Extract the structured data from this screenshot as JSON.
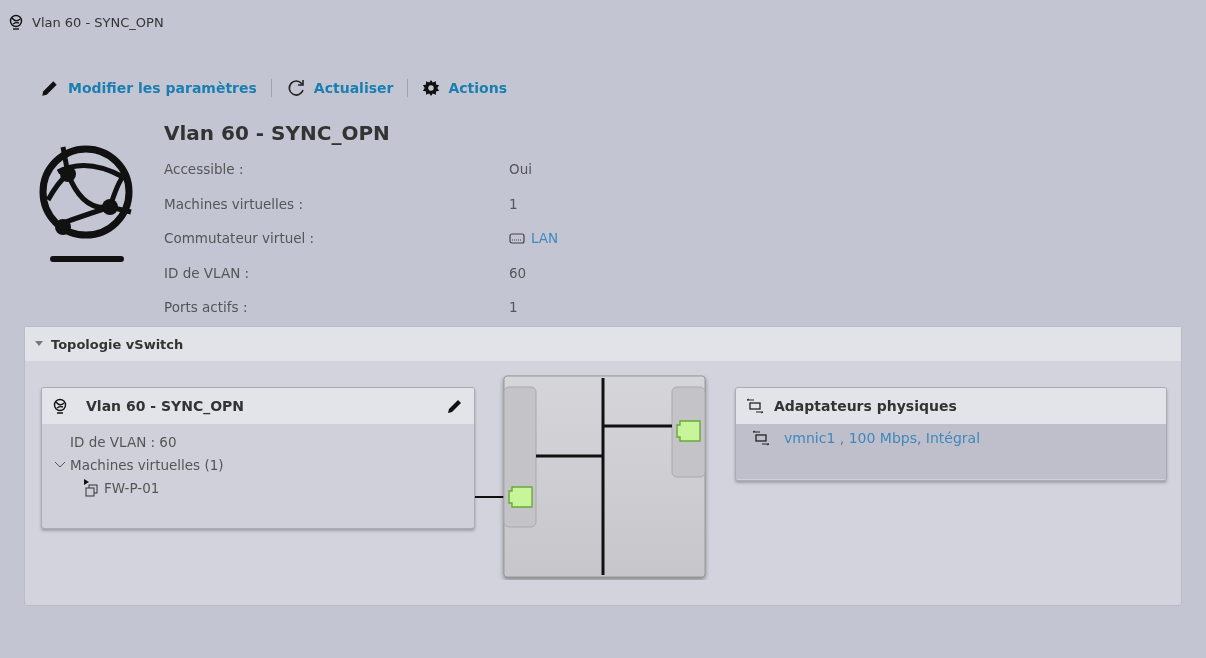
{
  "window": {
    "title": "Vlan 60 - SYNC_OPN"
  },
  "toolbar": [
    {
      "label": "Modifier les paramètres",
      "kind": "edit"
    },
    {
      "label": "Actualiser",
      "kind": "refresh"
    },
    {
      "label": "Actions",
      "kind": "gear"
    }
  ],
  "summary": {
    "title": "Vlan 60 - SYNC_OPN",
    "properties": [
      {
        "label": "Accessible :",
        "value": "Oui",
        "kind": "text"
      },
      {
        "label": "Machines virtuelles :",
        "value": "1",
        "kind": "text"
      },
      {
        "label": "Commutateur virtuel :",
        "value": "LAN",
        "kind": "link"
      },
      {
        "label": "ID de VLAN :",
        "value": "60",
        "kind": "text"
      },
      {
        "label": "Ports actifs :",
        "value": "1",
        "kind": "text"
      }
    ]
  },
  "topology": {
    "title": "Topologie vSwitch",
    "expanded": true,
    "port_group": {
      "title": "Vlan 60 - SYNC_OPN",
      "vlan": "ID de VLAN : 60",
      "vms": {
        "label": "Machines virtuelles (1)",
        "expanded": true,
        "children": [
          {
            "label": "FW-P-01"
          }
        ]
      }
    },
    "adapters": {
      "title": "Adaptateurs physiques",
      "items": [
        {
          "label": "vmnic1 , 100 Mbps, Intégral"
        }
      ]
    }
  }
}
